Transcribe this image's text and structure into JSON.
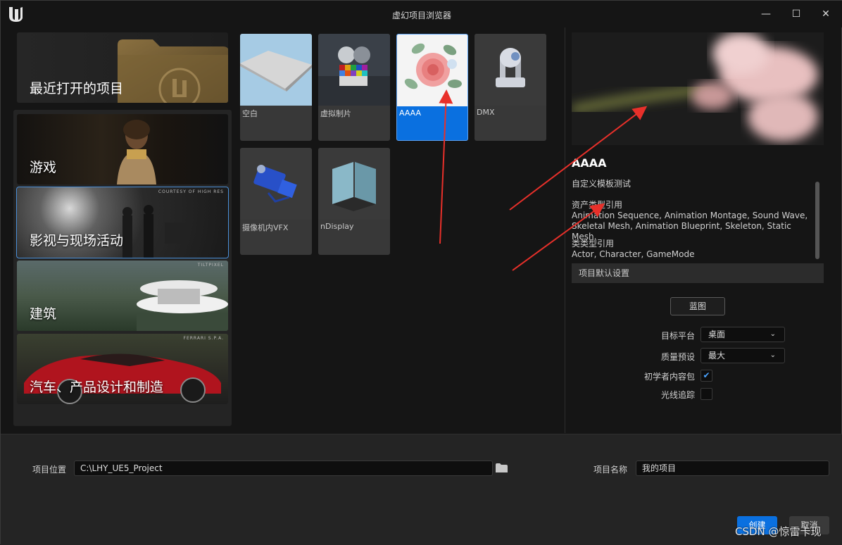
{
  "window": {
    "title": "虚幻项目浏览器",
    "minimize": "—",
    "maximize": "☐",
    "close": "✕"
  },
  "categories": {
    "recent": "最近打开的项目",
    "items": [
      {
        "label": "游戏",
        "credit": ""
      },
      {
        "label": "影视与现场活动",
        "credit": "COURTESY OF HIGH RES"
      },
      {
        "label": "建筑",
        "credit": "TILTPIXEL"
      },
      {
        "label": "汽车、产品设计和制造",
        "credit": "FERRARI S.P.A."
      }
    ]
  },
  "templates": [
    {
      "label": "空白"
    },
    {
      "label": "虚拟制片"
    },
    {
      "label": "AAAA"
    },
    {
      "label": "DMX"
    },
    {
      "label": "摄像机内VFX"
    },
    {
      "label": "nDisplay"
    }
  ],
  "details": {
    "title": "AAAA",
    "description": "自定义模板测试",
    "asset_types_heading": "资产类型引用",
    "asset_types": "Animation Sequence, Animation Montage, Sound Wave, Skeletal Mesh, Animation Blueprint, Skeleton, Static Mesh.",
    "class_types_heading": "类类型引用",
    "class_types": "Actor, Character, GameMode",
    "section_title": "项目默认设置",
    "blueprint_button": "蓝图",
    "target_platform_label": "目标平台",
    "target_platform_value": "桌面",
    "quality_label": "质量预设",
    "quality_value": "最大",
    "starter_content_label": "初学者内容包",
    "starter_content_checked": true,
    "raytracing_label": "光线追踪",
    "raytracing_checked": false
  },
  "bottom": {
    "location_label": "项目位置",
    "location_value": "C:\\LHY_UE5_Project",
    "name_label": "项目名称",
    "name_value": "我的项目",
    "create_button": "创建",
    "cancel_button": "取消"
  },
  "watermark": "CSDN @惊雷卡现",
  "colors": {
    "accent": "#0a70e0",
    "annotation": "#e8302a"
  }
}
